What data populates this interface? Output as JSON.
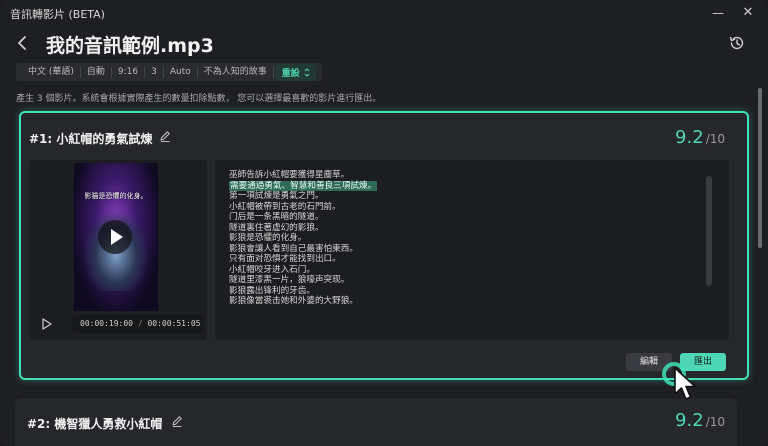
{
  "window": {
    "app_title": "音訊轉影片 (BETA)",
    "min_glyph": "—",
    "close_glyph": "✕"
  },
  "header": {
    "title": "我的音訊範例.mp3"
  },
  "meta_tags": [
    "中文 (華語)",
    "自動",
    "9:16",
    "3",
    "Auto",
    "不為人知的故事"
  ],
  "settings_label": "重設",
  "subtitle": "產生 3 個影片。系統會根據實際產生的數量扣除點數， 您可以選擇最喜歡的影片進行匯出。",
  "results": [
    {
      "title": "#1:  小紅帽的勇氣試煉",
      "score": "9.2",
      "score_den": "/10",
      "thumbnail_caption": "影猫是恐懼的化身。",
      "time_current": "00:00:19:00",
      "time_separator": "/",
      "time_total": "00:00:51:05",
      "script_lines": [
        "巫師告訴小紅帽要獲得星塵草。",
        "需要通過勇氣、智慧和善良三項試煉。",
        "第一項試煉是勇氣之門。",
        "小紅帽被帶到古老的石門前。",
        "门后是一条黑暗的隧道。",
        "隧道裏住著虛幻的影狼。",
        "影狼是恐懼的化身。",
        "影狼會讓人看到自己最害怕東西。",
        "只有面对恐惧才能找到出口。",
        "小紅帽咬牙进入石门。",
        "隧道里漆黑一片，狼嚎声突现。",
        "影狼露出锋利的牙齿。",
        "影狼像當裘击她和外婆的大野狼。"
      ],
      "highlighted_line_index": 1,
      "edit_label": "編輯",
      "export_label": "匯出"
    },
    {
      "title": "#2:  機智獵人勇救小紅帽",
      "score": "9.2",
      "score_den": "/10"
    }
  ],
  "colors": {
    "accent": "#3ee0b5",
    "highlight": "#2e6a56",
    "background": "#1e1f22",
    "card": "#26272b"
  },
  "icons": [
    "back-arrow-icon",
    "history-icon",
    "pencil-icon",
    "play-icon",
    "chevron-updown-icon",
    "cursor-icon"
  ]
}
